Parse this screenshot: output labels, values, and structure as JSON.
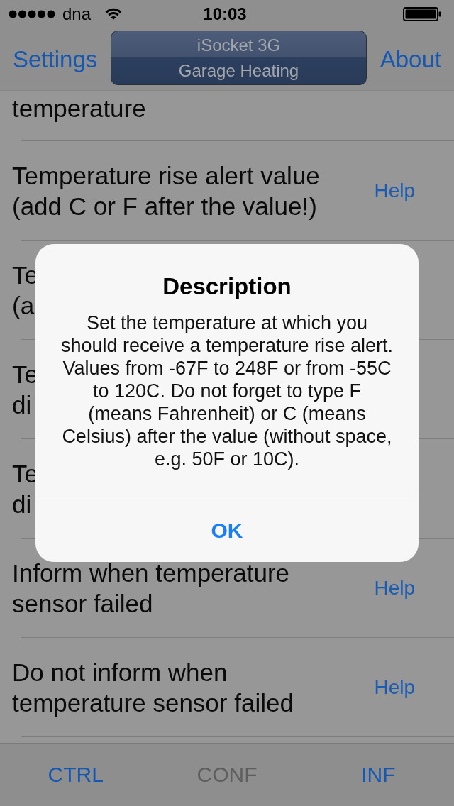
{
  "status_bar": {
    "carrier": "dna",
    "time": "10:03"
  },
  "nav_bar": {
    "left_button": "Settings",
    "title_button": {
      "line_1": "iSocket 3G",
      "line_2": "Garage Heating"
    },
    "right_button": "About"
  },
  "rows": [
    {
      "kind": "clipped",
      "label": "temperature"
    },
    {
      "kind": "normal",
      "label": "Temperature rise alert value\n(add C or F after the value!)",
      "help": "Help"
    },
    {
      "kind": "normal",
      "label": "Te\n(a"
    },
    {
      "kind": "normal",
      "label": "Te\ndi"
    },
    {
      "kind": "normal",
      "label": "Te\ndi"
    },
    {
      "kind": "normal",
      "label": "Inform when temperature\nsensor failed",
      "help": "Help"
    },
    {
      "kind": "normal",
      "label": "Do not inform when\ntemperature sensor failed",
      "help": "Help"
    }
  ],
  "alert": {
    "title": "Description",
    "message": "Set the temperature at which you should receive a temperature rise alert. Values from -67F to 248F or from -55C to 120C. Do not forget to type F (means Fahrenheit) or C (means Celsius) after the value (without space, e.g. 50F or 10C).",
    "button": "OK"
  },
  "tab_bar": {
    "tabs": [
      {
        "label": "CTRL",
        "selected": false
      },
      {
        "label": "CONF",
        "selected": true
      },
      {
        "label": "INF",
        "selected": false
      }
    ]
  }
}
